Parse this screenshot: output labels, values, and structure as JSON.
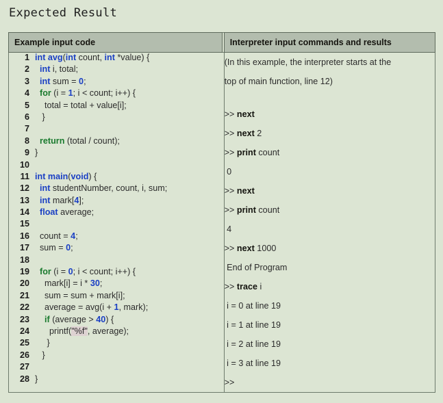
{
  "page": {
    "title": "Expected Result",
    "background_color": "#dce5d3",
    "header_background_color": "#b3bdae",
    "border_color": "#6d7a6b"
  },
  "table": {
    "headers": {
      "left": "Example input code",
      "right": "Interpreter input commands and results"
    },
    "code_lines": [
      {
        "n": "1",
        "html": "<span class='kw'>int</span> <span class='fn'>avg</span>(<span class='kw'>int</span> count, <span class='kw'>int</span> *value) {"
      },
      {
        "n": "2",
        "html": "  <span class='kw'>int</span> i, total;"
      },
      {
        "n": "3",
        "html": "  <span class='kw'>int</span> sum = <span class='num'>0</span>;"
      },
      {
        "n": "4",
        "html": "  <span class='kwg'>for</span> (i = <span class='num'>1</span>; i &lt; count; i++) {"
      },
      {
        "n": "5",
        "html": "    total = total + value[i];"
      },
      {
        "n": "6",
        "html": "   }"
      },
      {
        "n": "7",
        "html": ""
      },
      {
        "n": "8",
        "html": "  <span class='kwg'>return</span> (total / count);"
      },
      {
        "n": "9",
        "html": "}"
      },
      {
        "n": "10",
        "html": ""
      },
      {
        "n": "11",
        "html": "<span class='kw'>int</span> <span class='fn'>main</span>(<span class='kw'>void</span>) {"
      },
      {
        "n": "12",
        "html": "  <span class='kw'>int</span> studentNumber, count, i, sum;"
      },
      {
        "n": "13",
        "html": "  <span class='kw'>int</span> mark[<span class='num'>4</span>];"
      },
      {
        "n": "14",
        "html": "  <span class='kw'>float</span> average;"
      },
      {
        "n": "15",
        "html": ""
      },
      {
        "n": "16",
        "html": "  count = <span class='num'>4</span>;"
      },
      {
        "n": "17",
        "html": "  sum = <span class='num'>0</span>;"
      },
      {
        "n": "18",
        "html": ""
      },
      {
        "n": "19",
        "html": "  <span class='kwg'>for</span> (i = <span class='num'>0</span>; i &lt; count; i++) {"
      },
      {
        "n": "20",
        "html": "    mark[i] = i * <span class='num'>30</span>;"
      },
      {
        "n": "21",
        "html": "    sum = sum + mark[i];"
      },
      {
        "n": "22",
        "html": "    average = avg(i + <span class='num'>1</span>, mark);"
      },
      {
        "n": "23",
        "html": "    <span class='kwg'>if</span> (average &gt; <span class='num'>40</span>) {"
      },
      {
        "n": "24",
        "html": "      printf(<span class='str'>\"%f\"</span>, average);"
      },
      {
        "n": "25",
        "html": "     }"
      },
      {
        "n": "26",
        "html": "   }"
      },
      {
        "n": "27",
        "html": ""
      },
      {
        "n": "28",
        "html": "}"
      }
    ],
    "code_lines_plain": [
      "int avg(int count, int *value) {",
      "  int i, total;",
      "  int sum = 0;",
      "  for (i = 1; i < count; i++) {",
      "    total = total + value[i];",
      "   }",
      "",
      "  return (total / count);",
      "}",
      "",
      "int main(void) {",
      "  int studentNumber, count, i, sum;",
      "  int mark[4];",
      "  float average;",
      "",
      "  count = 4;",
      "  sum = 0;",
      "",
      "  for (i = 0; i < count; i++) {",
      "    mark[i] = i * 30;",
      "    sum = sum + mark[i];",
      "    average = avg(i + 1, mark);",
      "    if (average > 40) {",
      "      printf(\"%f\", average);",
      "     }",
      "   }",
      "",
      "}"
    ],
    "terminal_lines": [
      {
        "kind": "note",
        "html": "(In this example, the interpreter starts at the",
        "text": "(In this example, the interpreter starts at the"
      },
      {
        "kind": "note",
        "html": "top of main function, line 12)",
        "text": "top of main function, line 12)"
      },
      {
        "kind": "blank",
        "html": "",
        "text": ""
      },
      {
        "kind": "prompt",
        "html": "<span class='prompt'>&gt;&gt; </span><span class='cmd'>next</span>",
        "text": ">> next"
      },
      {
        "kind": "prompt",
        "html": "<span class='prompt'>&gt;&gt; </span><span class='cmd'>next</span><span class='arg'> 2</span>",
        "text": ">> next 2"
      },
      {
        "kind": "prompt",
        "html": "<span class='prompt'>&gt;&gt; </span><span class='cmd'>print</span><span class='arg'> count</span>",
        "text": ">> print count"
      },
      {
        "kind": "output",
        "html": "<span class='outp'> 0</span>",
        "text": " 0"
      },
      {
        "kind": "prompt",
        "html": "<span class='prompt'>&gt;&gt; </span><span class='cmd'>next</span>",
        "text": ">> next"
      },
      {
        "kind": "prompt",
        "html": "<span class='prompt'>&gt;&gt; </span><span class='cmd'>print</span><span class='arg'> count</span>",
        "text": ">> print count"
      },
      {
        "kind": "output",
        "html": "<span class='outp'> 4</span>",
        "text": " 4"
      },
      {
        "kind": "prompt",
        "html": "<span class='prompt'>&gt;&gt; </span><span class='cmd'>next</span><span class='arg'> 1000</span>",
        "text": ">> next 1000"
      },
      {
        "kind": "output",
        "html": "<span class='outp'> End of Program</span>",
        "text": " End of Program"
      },
      {
        "kind": "prompt",
        "html": "<span class='prompt'>&gt;&gt; </span><span class='cmd'>trace</span><span class='arg'> i</span>",
        "text": ">> trace i"
      },
      {
        "kind": "output",
        "html": "<span class='outp'> i = 0 at line 19</span>",
        "text": " i = 0 at line 19"
      },
      {
        "kind": "output",
        "html": "<span class='outp'> i = 1 at line 19</span>",
        "text": " i = 1 at line 19"
      },
      {
        "kind": "output",
        "html": "<span class='outp'> i = 2 at line 19</span>",
        "text": " i = 2 at line 19"
      },
      {
        "kind": "output",
        "html": "<span class='outp'> i = 3 at line 19</span>",
        "text": " i = 3 at line 19"
      },
      {
        "kind": "prompt",
        "html": "<span class='prompt'>&gt;&gt;</span>",
        "text": ">>"
      }
    ]
  }
}
